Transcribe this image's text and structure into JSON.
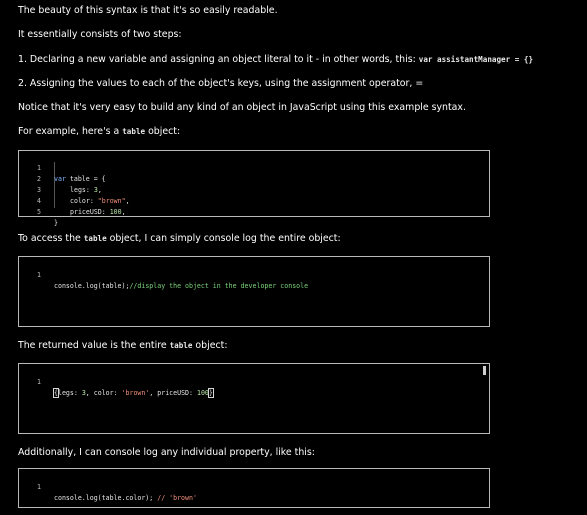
{
  "paragraphs": {
    "p1": "The beauty of this syntax is that it's so easily readable.",
    "p2": "It essentially consists of two steps:",
    "p3_text": "1. Declaring a new variable and assigning an object literal to it - in other words, this: ",
    "p3_code": "var assistantManager = {}",
    "p4": "2. Assigning the values to each of the object's keys, using the assignment operator, =",
    "p5": "Notice that it's very easy to build any kind of an object in JavaScript using this example syntax.",
    "p6_before": "For example, here's a ",
    "p6_code": "table",
    "p6_after": " object:",
    "p7_before": "To access the ",
    "p7_code": "table",
    "p7_after": " object, I can simply console log the entire object:",
    "p8_before": "The returned value is the entire ",
    "p8_code": "table",
    "p8_after": " object:",
    "p9": "Additionally, I can console log any individual property, like this:"
  },
  "editor1": {
    "lines": [
      {
        "n": "1",
        "kw": "var",
        "rest": " table = {"
      },
      {
        "n": "2",
        "key": "legs: ",
        "num": "3",
        "end": ","
      },
      {
        "n": "3",
        "key": "color: ",
        "str": "\"brown\"",
        "end": ","
      },
      {
        "n": "4",
        "key": "priceUSD: ",
        "num": "100",
        "end": ","
      },
      {
        "n": "5",
        "rest": "}"
      }
    ]
  },
  "editor2": {
    "lines": [
      {
        "n": "1",
        "code": "console.log(table);",
        "comment": "//display the object in the developer console"
      }
    ]
  },
  "editor3": {
    "lines": [
      {
        "n": "1",
        "open": "{",
        "key1": "legs: ",
        "num1": "3",
        "sep1": ", color: ",
        "str": "'brown'",
        "sep2": ", priceUSD: ",
        "num2": "100",
        "close": "}"
      }
    ]
  },
  "editor4": {
    "lines": [
      {
        "n": "1",
        "code": "console.log(table.color); ",
        "comment": "// 'brown'"
      }
    ]
  },
  "colors": {
    "background": "#000000",
    "text": "#ffffff",
    "editor_border": "#b9b9b9",
    "keyword": "#7fb6ff",
    "string": "#f18f7a",
    "number": "#b9e6a8",
    "comment": "#7ad37a"
  }
}
